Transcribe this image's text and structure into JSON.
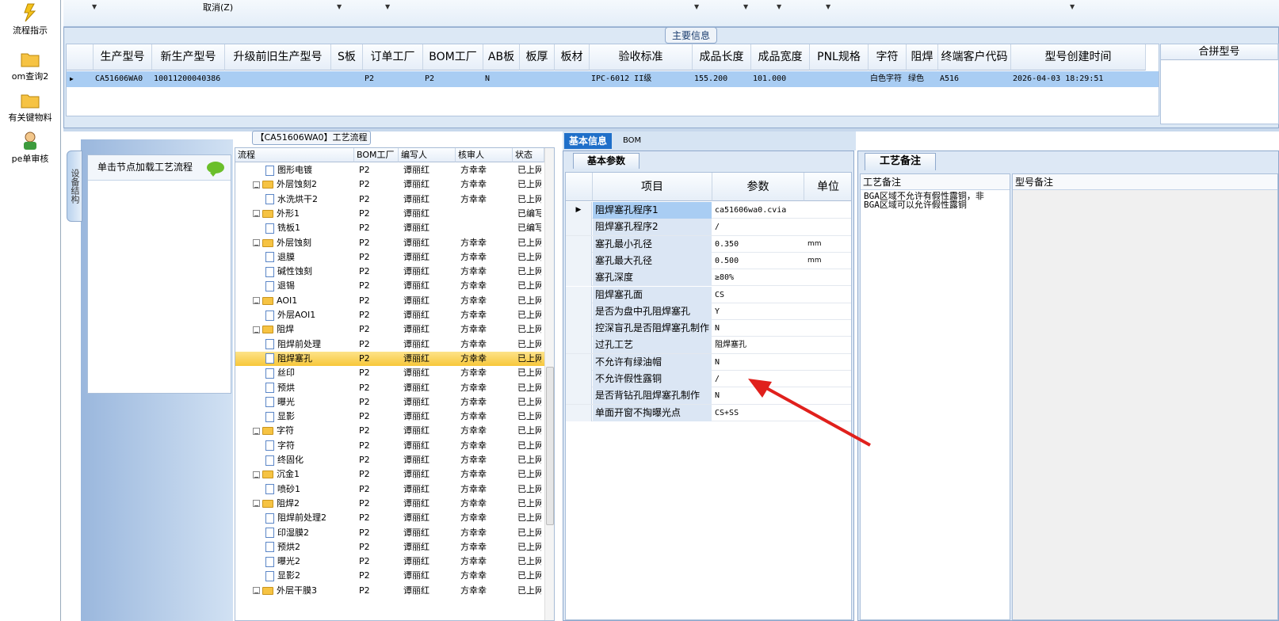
{
  "nav": {
    "items": [
      {
        "label": "流程指示",
        "icon": "lightning-icon"
      },
      {
        "label": "om查询2",
        "icon": "folder-icon"
      },
      {
        "label": "有关键物料",
        "icon": "folder-icon"
      },
      {
        "label": "pe单审核",
        "icon": "user-icon"
      }
    ]
  },
  "toolbar": {
    "cancel_label": "取消(Z)"
  },
  "main_info": {
    "title": "主要信息",
    "columns": [
      "生产型号",
      "新生产型号",
      "升级前旧生产型号",
      "S板",
      "订单工厂",
      "BOM工厂",
      "AB板",
      "板厚",
      "板材",
      "验收标准",
      "成品长度",
      "成品宽度",
      "PNL规格",
      "字符",
      "阻焊",
      "终端客户代码",
      "型号创建时间"
    ],
    "row": [
      "CA51606WA0",
      "10011200040386",
      "",
      "",
      "P2",
      "P2",
      "N",
      "",
      "",
      "IPC-6012 II级",
      "155.200",
      "101.000",
      "",
      "白色字符",
      "绿色",
      "A516",
      "2026-04-03 18:29:51"
    ],
    "merge_header": "合拼型号"
  },
  "left_panel": {
    "vertical_tab": "设备结构",
    "load_hint": "单击节点加载工艺流程"
  },
  "process": {
    "title": "【CA51606WA0】工艺流程",
    "columns": [
      "流程",
      "BOM工厂",
      "编写人",
      "核审人",
      "状态"
    ],
    "rows": [
      {
        "name": "图形电镀",
        "level": 2,
        "type": "doc",
        "factory": "P2",
        "author": "谭丽红",
        "reviewer": "方幸幸",
        "status": "已上网"
      },
      {
        "name": "外层蚀刻2",
        "level": 1,
        "type": "folder",
        "factory": "P2",
        "author": "谭丽红",
        "reviewer": "方幸幸",
        "status": "已上网"
      },
      {
        "name": "水洗烘干2",
        "level": 2,
        "type": "doc",
        "factory": "P2",
        "author": "谭丽红",
        "reviewer": "方幸幸",
        "status": "已上网"
      },
      {
        "name": "外形1",
        "level": 1,
        "type": "folder",
        "factory": "P2",
        "author": "谭丽红",
        "reviewer": "",
        "status": "已编写"
      },
      {
        "name": "铣板1",
        "level": 2,
        "type": "doc",
        "factory": "P2",
        "author": "谭丽红",
        "reviewer": "",
        "status": "已编写"
      },
      {
        "name": "外层蚀刻",
        "level": 1,
        "type": "folder",
        "factory": "P2",
        "author": "谭丽红",
        "reviewer": "方幸幸",
        "status": "已上网"
      },
      {
        "name": "退膜",
        "level": 2,
        "type": "doc",
        "factory": "P2",
        "author": "谭丽红",
        "reviewer": "方幸幸",
        "status": "已上网"
      },
      {
        "name": "碱性蚀刻",
        "level": 2,
        "type": "doc",
        "factory": "P2",
        "author": "谭丽红",
        "reviewer": "方幸幸",
        "status": "已上网"
      },
      {
        "name": "退锡",
        "level": 2,
        "type": "doc",
        "factory": "P2",
        "author": "谭丽红",
        "reviewer": "方幸幸",
        "status": "已上网"
      },
      {
        "name": "AOI1",
        "level": 1,
        "type": "folder",
        "factory": "P2",
        "author": "谭丽红",
        "reviewer": "方幸幸",
        "status": "已上网"
      },
      {
        "name": "外层AOI1",
        "level": 2,
        "type": "doc",
        "factory": "P2",
        "author": "谭丽红",
        "reviewer": "方幸幸",
        "status": "已上网"
      },
      {
        "name": "阻焊",
        "level": 1,
        "type": "folder",
        "factory": "P2",
        "author": "谭丽红",
        "reviewer": "方幸幸",
        "status": "已上网"
      },
      {
        "name": "阻焊前处理",
        "level": 2,
        "type": "doc",
        "factory": "P2",
        "author": "谭丽红",
        "reviewer": "方幸幸",
        "status": "已上网"
      },
      {
        "name": "阻焊塞孔",
        "level": 2,
        "type": "doc",
        "factory": "P2",
        "author": "谭丽红",
        "reviewer": "方幸幸",
        "status": "已上网",
        "selected": true
      },
      {
        "name": "丝印",
        "level": 2,
        "type": "doc",
        "factory": "P2",
        "author": "谭丽红",
        "reviewer": "方幸幸",
        "status": "已上网"
      },
      {
        "name": "预烘",
        "level": 2,
        "type": "doc",
        "factory": "P2",
        "author": "谭丽红",
        "reviewer": "方幸幸",
        "status": "已上网"
      },
      {
        "name": "曝光",
        "level": 2,
        "type": "doc",
        "factory": "P2",
        "author": "谭丽红",
        "reviewer": "方幸幸",
        "status": "已上网"
      },
      {
        "name": "显影",
        "level": 2,
        "type": "doc",
        "factory": "P2",
        "author": "谭丽红",
        "reviewer": "方幸幸",
        "status": "已上网"
      },
      {
        "name": "字符",
        "level": 1,
        "type": "folder",
        "factory": "P2",
        "author": "谭丽红",
        "reviewer": "方幸幸",
        "status": "已上网"
      },
      {
        "name": "字符",
        "level": 2,
        "type": "doc",
        "factory": "P2",
        "author": "谭丽红",
        "reviewer": "方幸幸",
        "status": "已上网"
      },
      {
        "name": "终固化",
        "level": 2,
        "type": "doc",
        "factory": "P2",
        "author": "谭丽红",
        "reviewer": "方幸幸",
        "status": "已上网"
      },
      {
        "name": "沉金1",
        "level": 1,
        "type": "folder",
        "factory": "P2",
        "author": "谭丽红",
        "reviewer": "方幸幸",
        "status": "已上网"
      },
      {
        "name": "喷砂1",
        "level": 2,
        "type": "doc",
        "factory": "P2",
        "author": "谭丽红",
        "reviewer": "方幸幸",
        "status": "已上网"
      },
      {
        "name": "阻焊2",
        "level": 1,
        "type": "folder",
        "factory": "P2",
        "author": "谭丽红",
        "reviewer": "方幸幸",
        "status": "已上网"
      },
      {
        "name": "阻焊前处理2",
        "level": 2,
        "type": "doc",
        "factory": "P2",
        "author": "谭丽红",
        "reviewer": "方幸幸",
        "status": "已上网"
      },
      {
        "name": "印湿膜2",
        "level": 2,
        "type": "doc",
        "factory": "P2",
        "author": "谭丽红",
        "reviewer": "方幸幸",
        "status": "已上网"
      },
      {
        "name": "预烘2",
        "level": 2,
        "type": "doc",
        "factory": "P2",
        "author": "谭丽红",
        "reviewer": "方幸幸",
        "status": "已上网"
      },
      {
        "name": "曝光2",
        "level": 2,
        "type": "doc",
        "factory": "P2",
        "author": "谭丽红",
        "reviewer": "方幸幸",
        "status": "已上网"
      },
      {
        "name": "显影2",
        "level": 2,
        "type": "doc",
        "factory": "P2",
        "author": "谭丽红",
        "reviewer": "方幸幸",
        "status": "已上网"
      },
      {
        "name": "外层干膜3",
        "level": 1,
        "type": "folder",
        "factory": "P2",
        "author": "谭丽红",
        "reviewer": "方幸幸",
        "status": "已上网"
      }
    ]
  },
  "params": {
    "tabs": [
      "基本信息",
      "BOM"
    ],
    "subtab": "基本参数",
    "columns": [
      "项目",
      "参数",
      "单位"
    ],
    "rows": [
      {
        "item": "阻焊塞孔程序1",
        "value": "ca51606wa0.cvia",
        "unit": "",
        "selected": true
      },
      {
        "item": "阻焊塞孔程序2",
        "value": "/",
        "unit": ""
      },
      {
        "item": "塞孔最小孔径",
        "value": "0.350",
        "unit": "mm"
      },
      {
        "item": "塞孔最大孔径",
        "value": "0.500",
        "unit": "mm"
      },
      {
        "item": "塞孔深度",
        "value": "≥80%",
        "unit": ""
      },
      {
        "item": "阻焊塞孔面",
        "value": "CS",
        "unit": ""
      },
      {
        "item": "是否为盘中孔阻焊塞孔",
        "value": "Y",
        "unit": ""
      },
      {
        "item": "控深盲孔是否阻焊塞孔制作",
        "value": "N",
        "unit": ""
      },
      {
        "item": "过孔工艺",
        "value": "阻焊塞孔",
        "unit": ""
      },
      {
        "item": "不允许有绿油帽",
        "value": "N",
        "unit": ""
      },
      {
        "item": "不允许假性露铜",
        "value": "/",
        "unit": ""
      },
      {
        "item": "是否背钻孔阻焊塞孔制作",
        "value": "N",
        "unit": ""
      },
      {
        "item": "单面开窗不掏曝光点",
        "value": "CS+SS",
        "unit": ""
      }
    ]
  },
  "remarks": {
    "tab": "工艺备注",
    "process_header": "工艺备注",
    "model_header": "型号备注",
    "process_text": "BGA区域不允许有假性露铜，非\nBGA区域可以允许假性露铜"
  },
  "colors": {
    "accent": "#1f6fc9",
    "selection": "#a9cdf3",
    "tree_selection": "#f7c73a",
    "arrow": "#e0201c"
  }
}
